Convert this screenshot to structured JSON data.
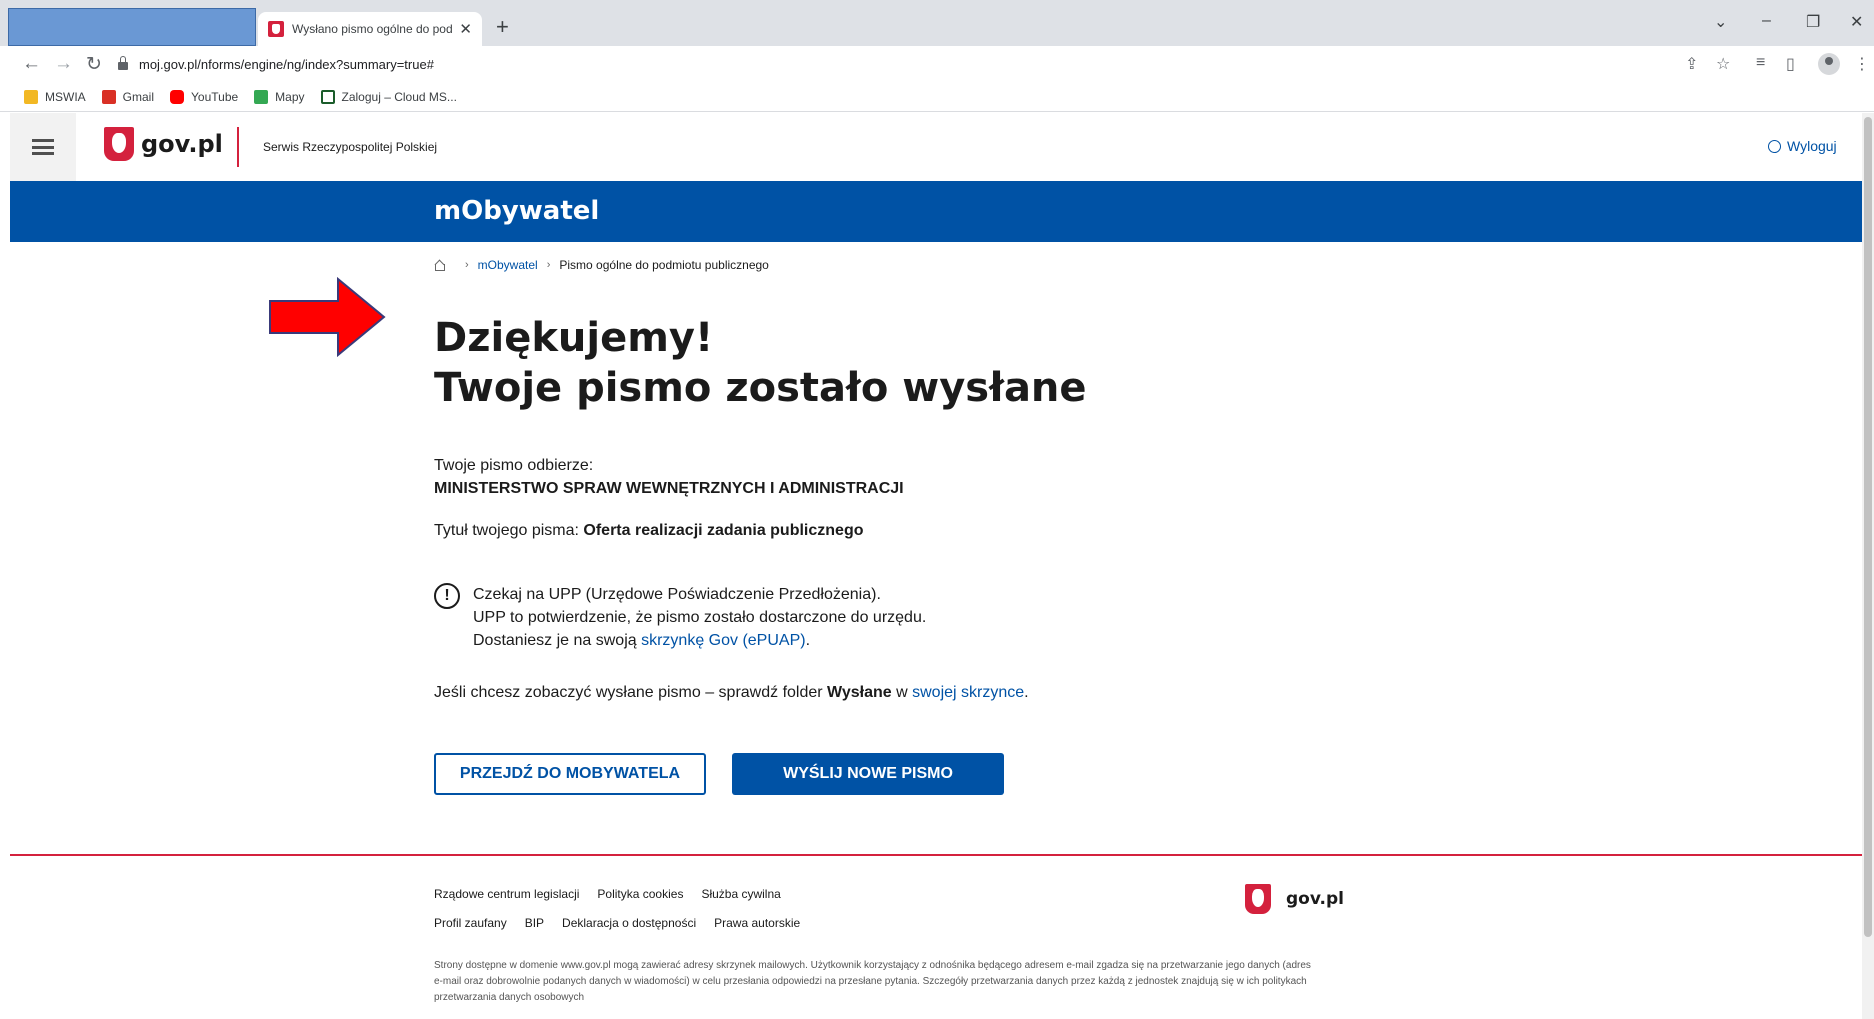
{
  "browser": {
    "tab_title": "Wysłano pismo ogólne do podm",
    "tab_close": "✕",
    "new_tab": "+",
    "url": "moj.gov.pl/nforms/engine/ng/index?summary=true#",
    "bookmarks": [
      {
        "label": "MSWIA",
        "icon": "folder-icon",
        "color": "#f2b824"
      },
      {
        "label": "Gmail",
        "icon": "gmail-icon",
        "color": "#d93025"
      },
      {
        "label": "YouTube",
        "icon": "youtube-icon",
        "color": "#ff0000"
      },
      {
        "label": "Mapy",
        "icon": "maps-icon",
        "color": "#34a853"
      },
      {
        "label": "Zaloguj – Cloud MS...",
        "icon": "cloud-icon",
        "color": "#1a5c2a"
      }
    ]
  },
  "header": {
    "logo_text": "gov.pl",
    "serwis": "Serwis Rzeczypospolitej Polskiej",
    "logout": "Wyloguj"
  },
  "banner": {
    "title": "mObywatel"
  },
  "breadcrumb": {
    "item1": "mObywatel",
    "item2": "Pismo ogólne do podmiotu publicznego"
  },
  "main": {
    "heading_line1": "Dziękujemy!",
    "heading_line2": "Twoje pismo zostało wysłane",
    "recipient_label": "Twoje pismo odbierze:",
    "recipient_name": "MINISTERSTWO SPRAW WEWNĘTRZNYCH I ADMINISTRACJI",
    "title_label": "Tytuł twojego pisma: ",
    "title_value": "Oferta realizacji zadania publicznego",
    "info_line1": "Czekaj na UPP (Urzędowe Poświadczenie Przedłożenia).",
    "info_line2": "UPP to potwierdzenie, że pismo zostało dostarczone do urzędu.",
    "info_line3_prefix": "Dostaniesz je na swoją ",
    "info_line3_link": "skrzynkę Gov (ePUAP)",
    "info_line3_suffix": ".",
    "folder_prefix": "Jeśli chcesz zobaczyć wysłane pismo – sprawdź folder ",
    "folder_name": "Wysłane",
    "folder_mid": " w ",
    "folder_link": "swojej skrzynce",
    "folder_suffix": ".",
    "exclamation": "!",
    "btn_mobywatel": "PRZEJDŹ DO MOBYWATELA",
    "btn_new": "WYŚLIJ NOWE PISMO"
  },
  "footer": {
    "row1": [
      "Rządowe centrum legislacji",
      "Polityka cookies",
      "Służba cywilna"
    ],
    "row2": [
      "Profil zaufany",
      "BIP",
      "Deklaracja o dostępności",
      "Prawa autorskie"
    ],
    "logo_text": "gov.pl",
    "disclaimer": "Strony dostępne w domenie www.gov.pl mogą zawierać adresy skrzynek mailowych. Użytkownik korzystający z odnośnika będącego adresem e-mail zgadza się na przetwarzanie jego danych (adres e-mail oraz dobrowolnie podanych danych w wiadomości) w celu przesłania odpowiedzi na przesłane pytania. Szczegóły przetwarzania danych przez każdą z jednostek znajdują się w ich politykach przetwarzania danych osobowych"
  },
  "colors": {
    "accent_blue": "#0052a5",
    "accent_red": "#d4213d",
    "annotation_arrow": "#ff0000"
  }
}
